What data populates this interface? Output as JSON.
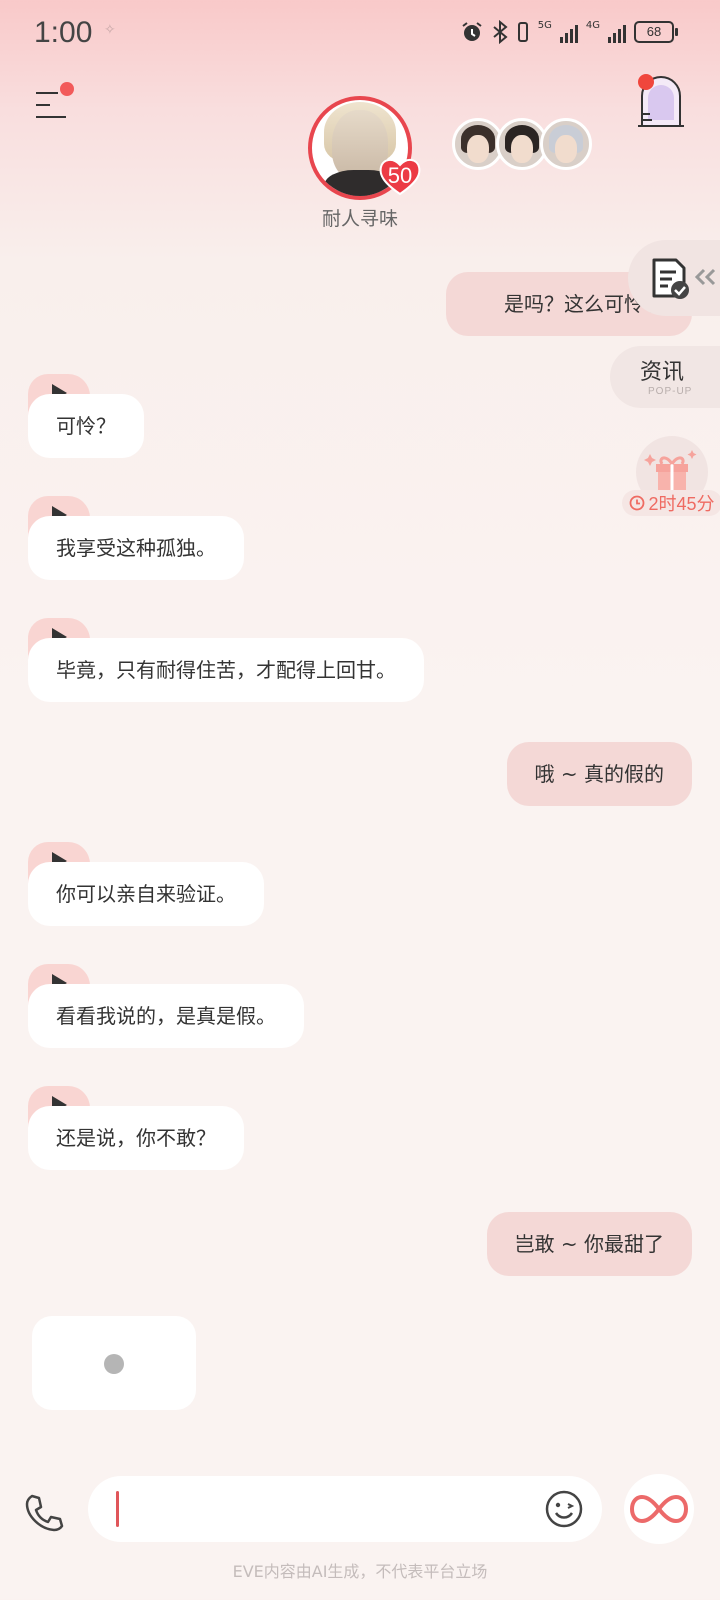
{
  "status_bar": {
    "time": "1:00",
    "battery": "68",
    "network_1": "5G",
    "network_2": "4G"
  },
  "header": {
    "character_name": "耐人寻味",
    "affinity_level": "50"
  },
  "side": {
    "news_label": "资讯",
    "news_sub": "POP-UP",
    "gift_timer": "2时45分"
  },
  "messages": [
    {
      "role": "user",
      "text": "是吗？这么可怜啊"
    },
    {
      "role": "ai",
      "text": "可怜？"
    },
    {
      "role": "ai",
      "text": "我享受这种孤独。"
    },
    {
      "role": "ai",
      "text": "毕竟，只有耐得住苦，才配得上回甘。"
    },
    {
      "role": "user",
      "text": "哦 ~ 真的假的"
    },
    {
      "role": "ai",
      "text": "你可以亲自来验证。"
    },
    {
      "role": "ai",
      "text": "看看我说的，是真是假。"
    },
    {
      "role": "ai",
      "text": "还是说，你不敢？"
    },
    {
      "role": "user",
      "text": "岂敢 ~ 你最甜了"
    }
  ],
  "footer": {
    "disclaimer": "EVE内容由AI生成，不代表平台立场",
    "input_value": ""
  },
  "colors": {
    "accent": "#e8464e",
    "user_bubble": "#f4d8d6",
    "ai_bubble": "#ffffff",
    "badge_red": "#f25a5a"
  }
}
